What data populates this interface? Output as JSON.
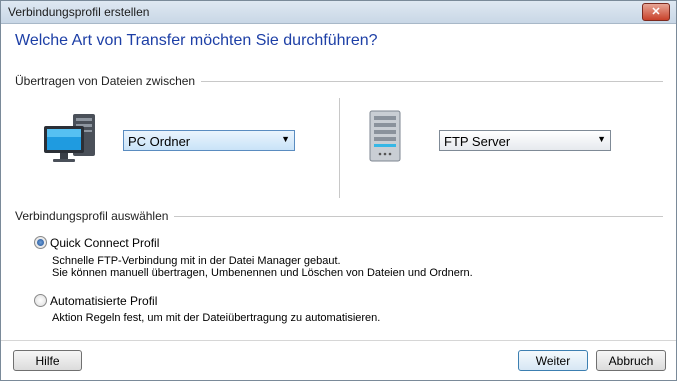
{
  "window": {
    "title": "Verbindungsprofil erstellen"
  },
  "heading": "Welche Art von Transfer möchten Sie durchführen?",
  "transfer": {
    "group_label": "Übertragen von Dateien zwischen",
    "source": {
      "icon": "pc-monitor-icon",
      "value": "PC Ordner"
    },
    "target": {
      "icon": "ftp-server-icon",
      "value": "FTP Server"
    }
  },
  "profile": {
    "group_label": "Verbindungsprofil auswählen",
    "options": [
      {
        "label": "Quick Connect Profil",
        "selected": true,
        "desc1": "Schnelle FTP-Verbindung mit in der Datei Manager gebaut.",
        "desc2": "Sie können manuell übertragen, Umbenennen und Löschen von Dateien und Ordnern."
      },
      {
        "label": "Automatisierte Profil",
        "selected": false,
        "desc1": "Aktion Regeln fest, um mit der Dateiübertragung zu automatisieren."
      }
    ]
  },
  "buttons": {
    "help": "Hilfe",
    "next": "Weiter",
    "cancel": "Abbruch"
  },
  "colors": {
    "heading": "#1d3fa6",
    "accent": "#1c4f97"
  }
}
